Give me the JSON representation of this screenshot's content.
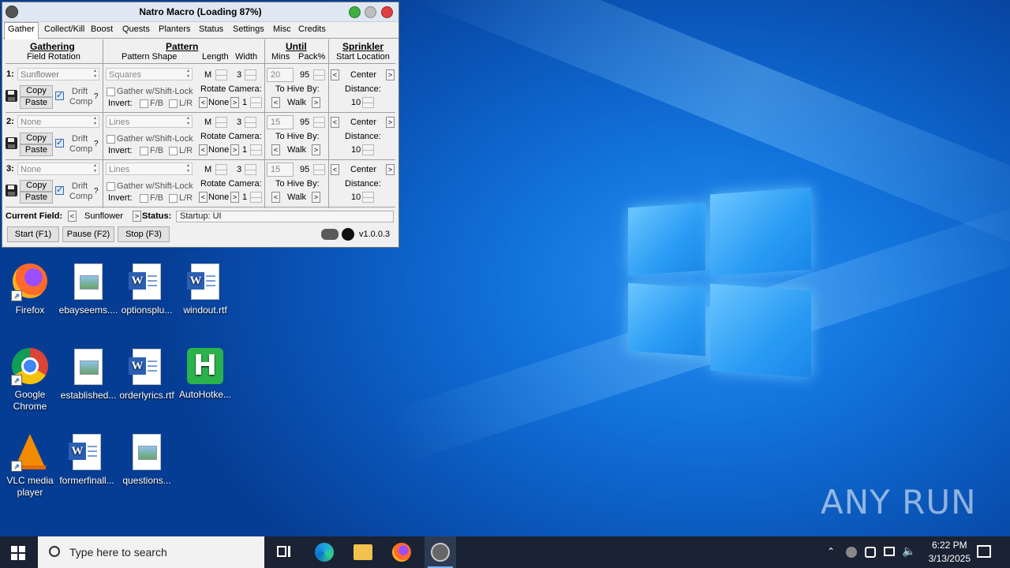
{
  "window": {
    "title": "Natro Macro (Loading 87%)",
    "tabs": [
      "Gather",
      "Collect/Kill",
      "Boost",
      "Quests",
      "Planters",
      "Status",
      "Settings",
      "Misc",
      "Credits"
    ],
    "headers": {
      "gathering": "Gathering",
      "field_rotation": "Field Rotation",
      "pattern": "Pattern",
      "pattern_shape": "Pattern Shape",
      "length": "Length",
      "width": "Width",
      "until": "Until",
      "mins": "Mins",
      "pack": "Pack%",
      "sprinkler": "Sprinkler",
      "start_location": "Start Location"
    },
    "rows": [
      {
        "num": "1:",
        "field": "Sunflower",
        "shape": "Squares",
        "length": "M",
        "width": "3",
        "mins": "20",
        "pack": "95",
        "location": "Center",
        "distance": "10"
      },
      {
        "num": "2:",
        "field": "None",
        "shape": "Lines",
        "length": "M",
        "width": "3",
        "mins": "15",
        "pack": "95",
        "location": "Center",
        "distance": "10"
      },
      {
        "num": "3:",
        "field": "None",
        "shape": "Lines",
        "length": "M",
        "width": "3",
        "mins": "15",
        "pack": "95",
        "location": "Center",
        "distance": "10"
      }
    ],
    "labels": {
      "copy": "Copy",
      "paste": "Paste",
      "drift": "Drift",
      "comp": "Comp",
      "help": "?",
      "shiftlock": "Gather w/Shift-Lock",
      "invert": "Invert:",
      "fb": "F/B",
      "lr": "L/R",
      "rotate": "Rotate Camera:",
      "rotate_val": "None",
      "rotate_num": "1",
      "tohive": "To Hive By:",
      "tohive_val": "Walk",
      "distance": "Distance:",
      "left": "<",
      "right": ">"
    },
    "footer": {
      "current_field_label": "Current Field:",
      "current_field": "Sunflower",
      "status_label": "Status:",
      "status": "Startup: UI",
      "start": "Start (F1)",
      "pause": "Pause (F2)",
      "stop": "Stop (F3)",
      "version": "v1.0.0.3"
    }
  },
  "desktop_icons": [
    {
      "label": "Firefox",
      "type": "firefox"
    },
    {
      "label": "ebayseems....",
      "type": "image"
    },
    {
      "label": "optionsplu...",
      "type": "word"
    },
    {
      "label": "windout.rtf",
      "type": "word"
    },
    {
      "label": "Google Chrome",
      "type": "chrome"
    },
    {
      "label": "established...",
      "type": "image"
    },
    {
      "label": "orderlyrics.rtf",
      "type": "word"
    },
    {
      "label": "AutoHotke...",
      "type": "ahk"
    },
    {
      "label": "VLC media player",
      "type": "vlc"
    },
    {
      "label": "formerfinall...",
      "type": "word"
    },
    {
      "label": "questions...",
      "type": "image"
    }
  ],
  "watermark": "ANY RUN",
  "taskbar": {
    "search_placeholder": "Type here to search",
    "time": "6:22 PM",
    "date": "3/13/2025"
  }
}
